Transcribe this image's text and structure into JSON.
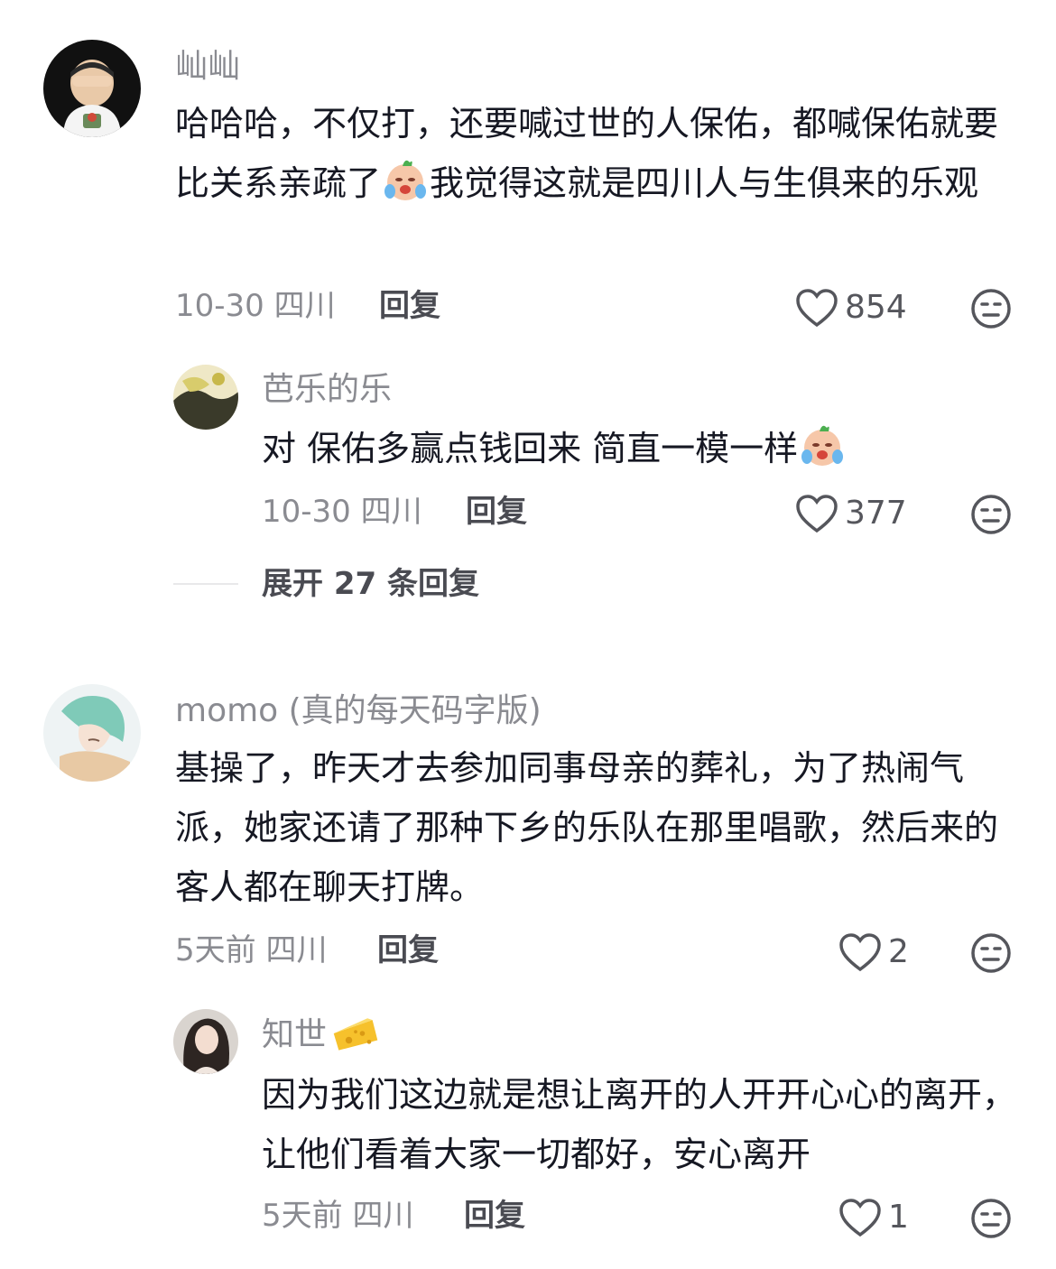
{
  "comments": [
    {
      "user": "屾屾",
      "text_parts": [
        "哈哈哈，不仅打，还要喊过世的人保佑，都喊保佑就要比关系亲疏了",
        "我觉得这就是四川人与生俱来的乐观"
      ],
      "emoji": "crying-face-emoji",
      "meta": "10-30 四川",
      "reply_label": "回复",
      "likes": "854",
      "replies": [
        {
          "user": "芭乐的乐",
          "text": "对 保佑多赢点钱回来 简直一模一样",
          "emoji": "crying-face-emoji",
          "meta": "10-30 四川",
          "reply_label": "回复",
          "likes": "377"
        }
      ],
      "expand_label": "展开 27 条回复"
    },
    {
      "user": "momo (真的每天码字版)",
      "text": "基操了，昨天才去参加同事母亲的葬礼，为了热闹气派，她家还请了那种下乡的乐队在那里唱歌，然后来的客人都在聊天打牌。",
      "meta": "5天前 四川",
      "reply_label": "回复",
      "likes": "2",
      "replies": [
        {
          "user": "知世",
          "user_badge": "cheese-emoji",
          "text": "因为我们这边就是想让离开的人开开心心的离开，让他们看着大家一切都好，安心离开",
          "meta": "5天前 四川",
          "reply_label": "回复",
          "likes": "1"
        }
      ]
    }
  ],
  "icons": {
    "like": "heart-outline-icon",
    "dislike": "meh-face-icon"
  },
  "colors": {
    "text": "#161823",
    "meta": "#8a8b91",
    "icon": "#55565c"
  }
}
